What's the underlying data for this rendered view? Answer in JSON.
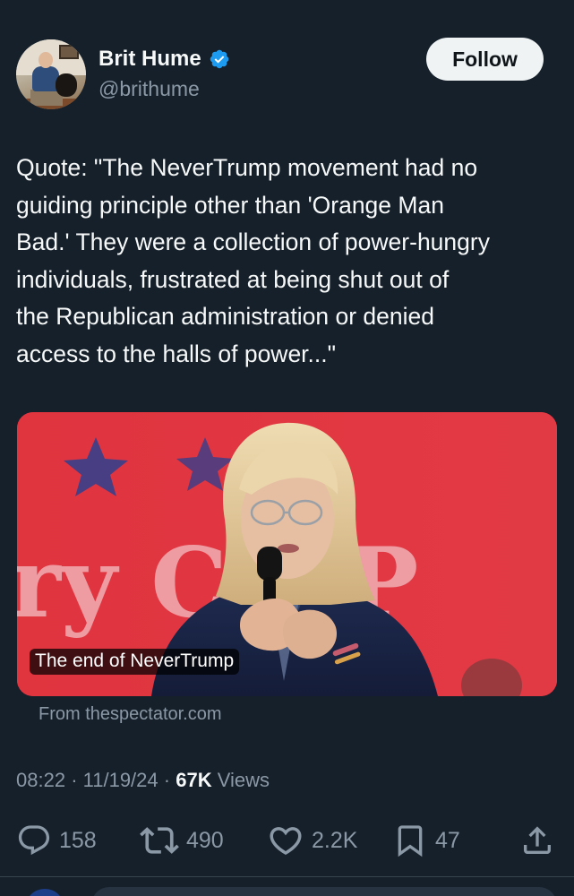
{
  "author": {
    "display_name": "Brit Hume",
    "handle": "@brithume",
    "verified": true
  },
  "follow_label": "Follow",
  "tweet": {
    "lines": [
      "Quote: \"The NeverTrump movement had no",
      "guiding principle other than 'Orange Man",
      "Bad.' They were a collection of power-hungry",
      "individuals, frustrated at being shut out of",
      "the Republican administration or denied",
      "access to the halls of power...\""
    ]
  },
  "card": {
    "title": "The end of NeverTrump",
    "source": "From thespectator.com",
    "backdrop_text": "ry C    r P"
  },
  "meta": {
    "time": "08:22",
    "date": "11/19/24",
    "views_count": "67K",
    "views_label": "Views",
    "separator": "·"
  },
  "actions": {
    "replies": "158",
    "reposts": "490",
    "likes": "2.2K",
    "bookmarks": "47"
  },
  "colors": {
    "background": "#15202b",
    "text_primary": "#f7f9f9",
    "text_secondary": "#8b98a5",
    "verified": "#1d9bf0",
    "card_backdrop": "#d8303c"
  }
}
